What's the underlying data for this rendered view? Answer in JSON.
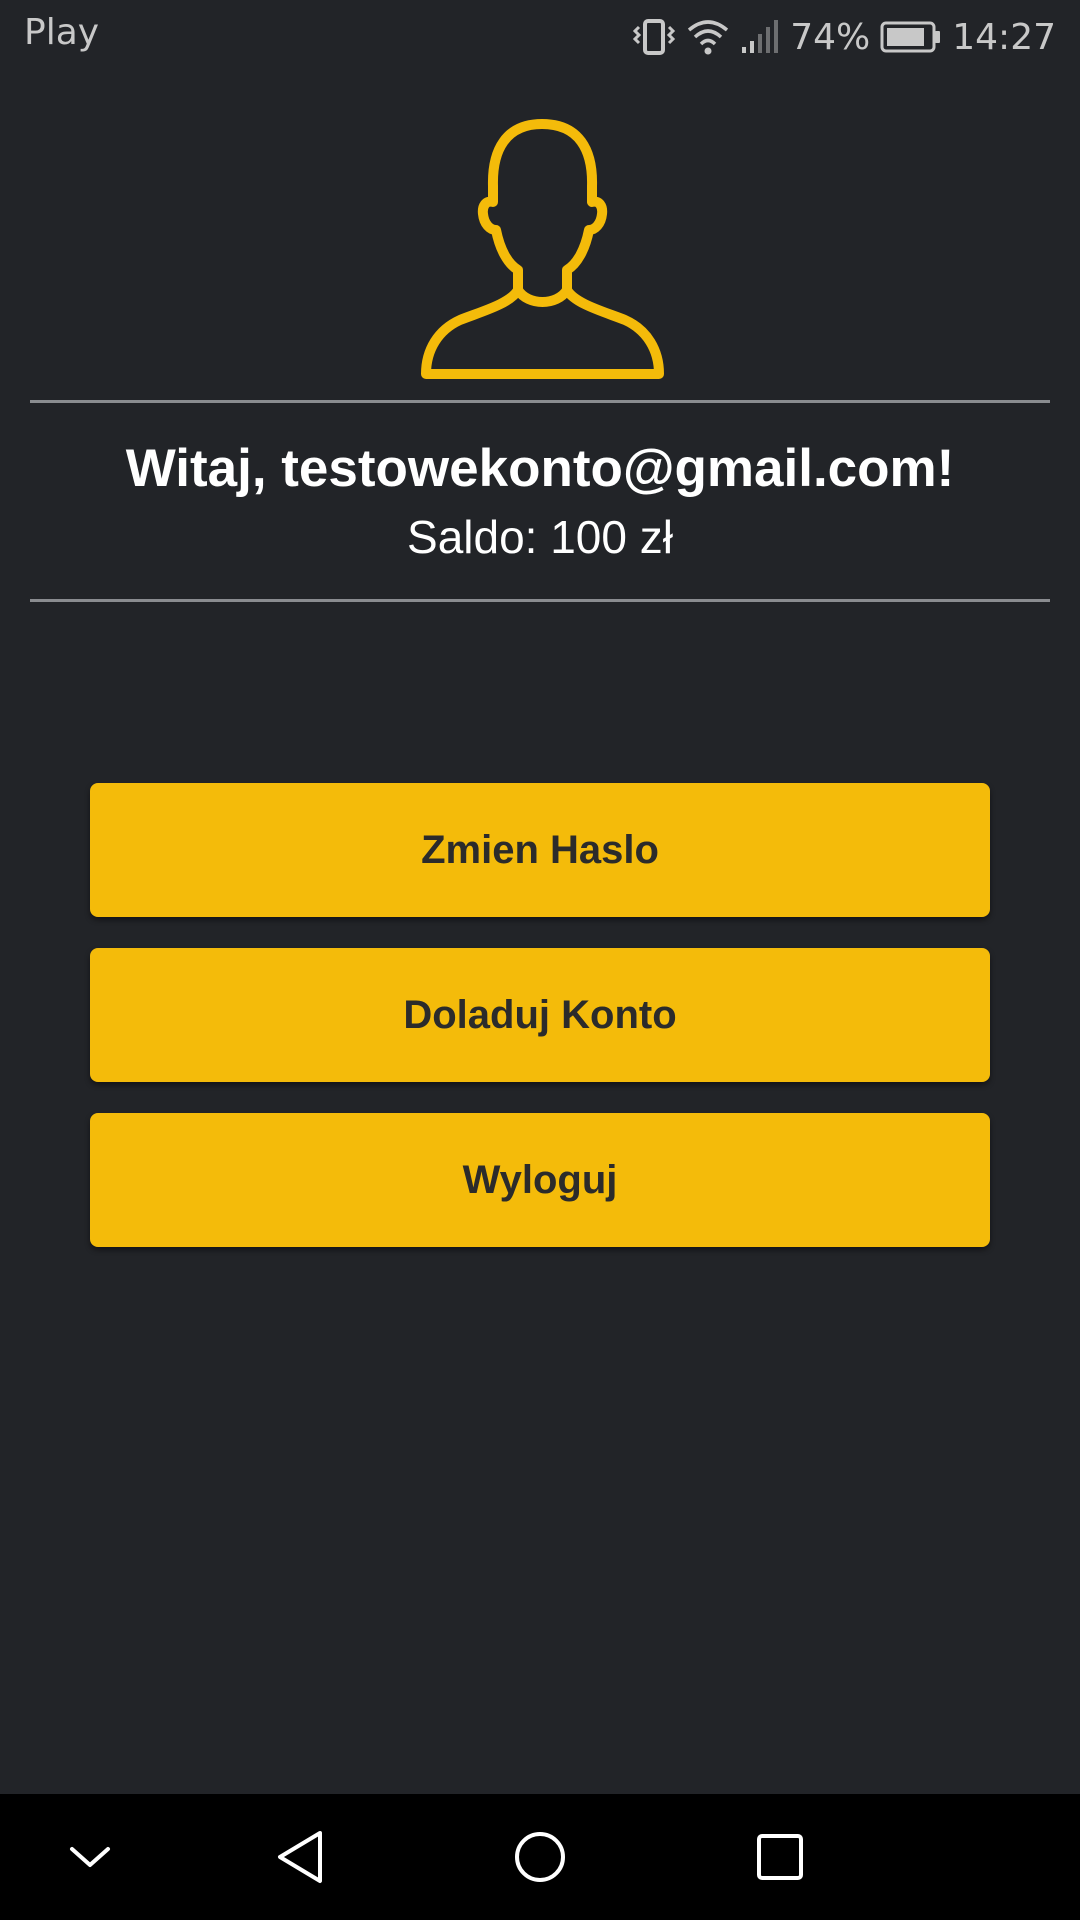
{
  "status_bar": {
    "carrier": "Play",
    "battery_percent": "74%",
    "time": "14:27",
    "icons": [
      "vibrate-icon",
      "wifi-icon",
      "signal-icon",
      "battery-icon"
    ]
  },
  "profile": {
    "avatar_icon": "user-silhouette-icon",
    "greeting": "Witaj, testowekonto@gmail.com!",
    "balance": "Saldo: 100 zł"
  },
  "actions": {
    "change_password": "Zmien Haslo",
    "top_up": "Doladuj Konto",
    "logout": "Wyloguj"
  },
  "nav_bar": {
    "icons": [
      "chevron-down-icon",
      "back-icon",
      "home-icon",
      "recents-icon"
    ]
  },
  "colors": {
    "background": "#222428",
    "accent": "#f4bb0a",
    "button_text": "#2b2b2b",
    "divider": "#8a8c90"
  }
}
